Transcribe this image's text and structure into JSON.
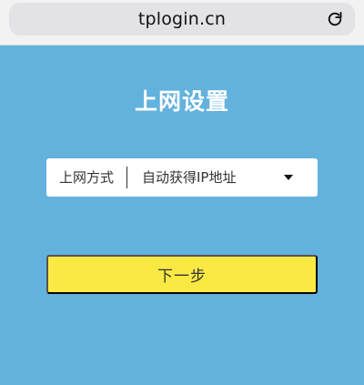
{
  "browser": {
    "url": "tplogin.cn",
    "reload_icon": "reload-icon"
  },
  "page": {
    "title": "上网设置"
  },
  "connection": {
    "label": "上网方式",
    "selected_value": "自动获得IP地址",
    "dropdown_icon": "triangle-down-icon"
  },
  "actions": {
    "next_label": "下一步"
  },
  "colors": {
    "background": "#63b2dd",
    "browser_bar": "#f2f2f3",
    "address_pill": "#e3e3e6",
    "primary_button": "#fae943",
    "title_text": "#ffffff"
  }
}
